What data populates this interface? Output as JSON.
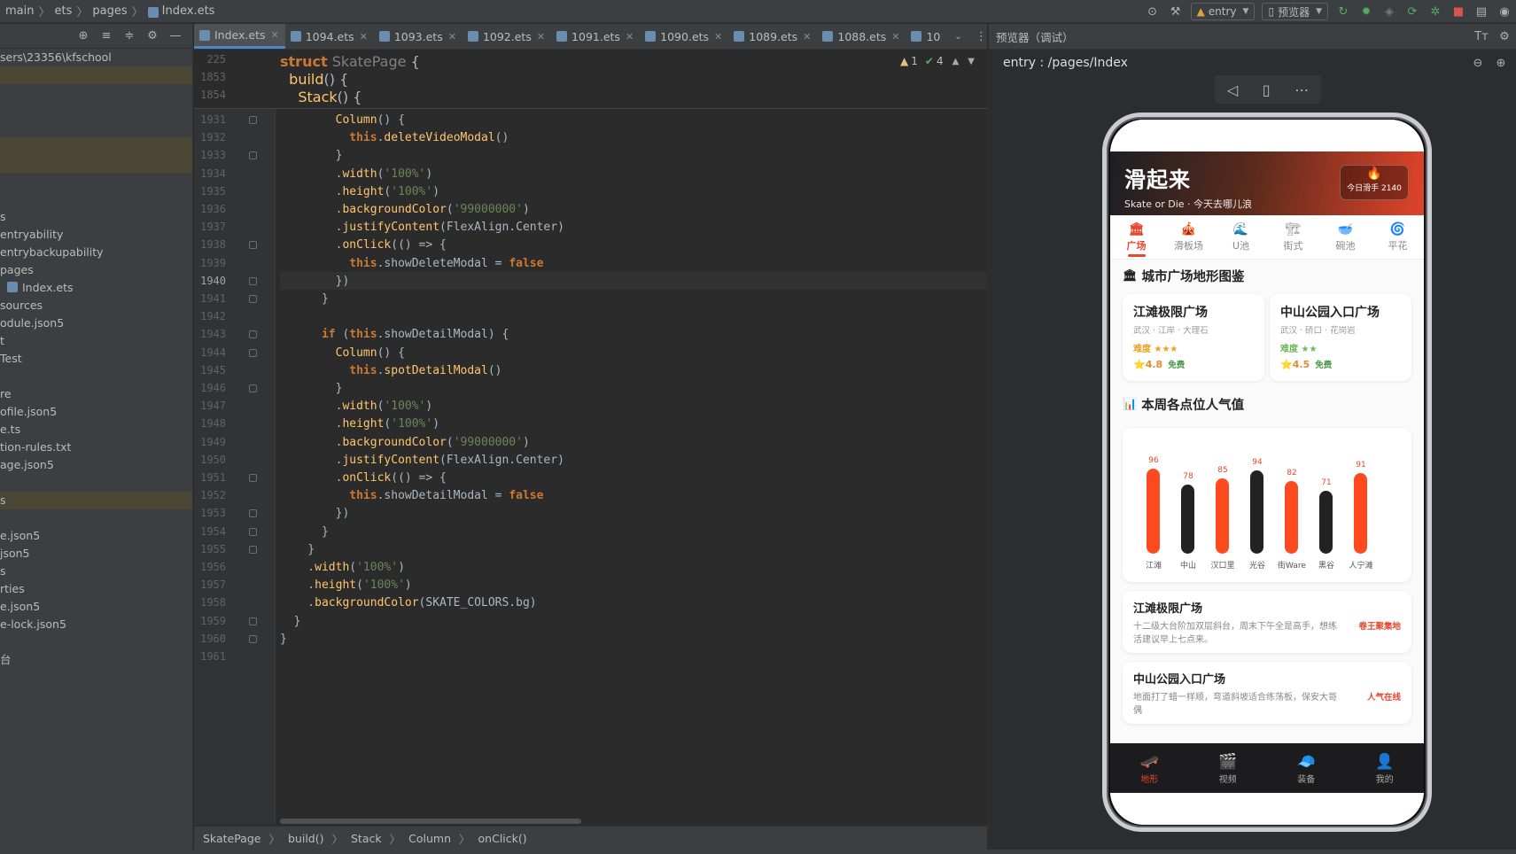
{
  "topbar": {
    "breadcrumb": [
      "main",
      "ets",
      "pages",
      "Index.ets"
    ],
    "module_select": "entry",
    "previewer_select": "预览器"
  },
  "project": {
    "path": "sers\\23356\\kfschool",
    "items": [
      {
        "text": "",
        "hl": true
      },
      {
        "text": "",
        "hl": false
      },
      {
        "text": "",
        "hl": false
      },
      {
        "text": "",
        "hl": false
      },
      {
        "text": "",
        "hl": true
      },
      {
        "text": "",
        "hl": true
      },
      {
        "text": "",
        "hl": false
      },
      {
        "text": "",
        "hl": false
      },
      {
        "text": "s",
        "hl": false
      },
      {
        "text": "entryability",
        "hl": false
      },
      {
        "text": "entrybackupability",
        "hl": false
      },
      {
        "text": "pages",
        "hl": false
      },
      {
        "text": "Index.ets",
        "hl": false,
        "icon": true
      },
      {
        "text": "sources",
        "hl": false
      },
      {
        "text": "odule.json5",
        "hl": false
      },
      {
        "text": "t",
        "hl": false
      },
      {
        "text": "Test",
        "hl": false
      },
      {
        "text": "",
        "hl": false
      },
      {
        "text": "re",
        "hl": false
      },
      {
        "text": "ofile.json5",
        "hl": false
      },
      {
        "text": "e.ts",
        "hl": false
      },
      {
        "text": "tion-rules.txt",
        "hl": false
      },
      {
        "text": "age.json5",
        "hl": false
      },
      {
        "text": "",
        "hl": false
      },
      {
        "text": "s",
        "hl": true
      },
      {
        "text": "",
        "hl": false
      },
      {
        "text": "e.json5",
        "hl": false
      },
      {
        "text": "json5",
        "hl": false
      },
      {
        "text": "s",
        "hl": false
      },
      {
        "text": "rties",
        "hl": false
      },
      {
        "text": "e.json5",
        "hl": false
      },
      {
        "text": "e-lock.json5",
        "hl": false
      },
      {
        "text": "",
        "hl": false
      },
      {
        "text": "台",
        "hl": false
      }
    ]
  },
  "tabs": [
    "Index.ets",
    "1094.ets",
    "1093.ets",
    "1092.ets",
    "1091.ets",
    "1090.ets",
    "1089.ets",
    "1088.ets",
    "10"
  ],
  "inspection": {
    "warnings": "1",
    "ok": "4"
  },
  "editor": {
    "sticky": [
      {
        "ln": "225",
        "html": "<span class='kw'>struct</span> <span class='dim'>SkatePage</span> {"
      },
      {
        "ln": "1853",
        "html": "  <span class='fn'>build</span>() {"
      },
      {
        "ln": "1854",
        "html": "    <span class='fn'>Stack</span>() {"
      }
    ],
    "lines": [
      {
        "ln": "1931",
        "html": "        <span class='fn'>Column</span>() {",
        "fold": true
      },
      {
        "ln": "1932",
        "html": "          <span class='kw'>this</span>.<span class='mth'>deleteVideoModal</span>()"
      },
      {
        "ln": "1933",
        "html": "        }",
        "fold": true
      },
      {
        "ln": "1934",
        "html": "        .<span class='mth'>width</span>(<span class='str'>'100%'</span>)"
      },
      {
        "ln": "1935",
        "html": "        .<span class='mth'>height</span>(<span class='str'>'100%'</span>)"
      },
      {
        "ln": "1936",
        "html": "        .<span class='mth'>backgroundColor</span>(<span class='str'>'99000000'</span>)"
      },
      {
        "ln": "1937",
        "html": "        .<span class='mth'>justifyContent</span>(FlexAlign.Center)"
      },
      {
        "ln": "1938",
        "html": "        .<span class='mth'>onClick</span>(() => {",
        "fold": true
      },
      {
        "ln": "1939",
        "html": "          <span class='kw'>this</span>.showDeleteModal = <span class='kw'>false</span>"
      },
      {
        "ln": "1940",
        "html": "        })",
        "fold": true,
        "cur": true
      },
      {
        "ln": "1941",
        "html": "      }",
        "fold": true
      },
      {
        "ln": "1942",
        "html": ""
      },
      {
        "ln": "1943",
        "html": "      <span class='kw'>if</span> (<span class='kw'>this</span>.showDetailModal) {",
        "fold": true
      },
      {
        "ln": "1944",
        "html": "        <span class='fn'>Column</span>() {",
        "fold": true
      },
      {
        "ln": "1945",
        "html": "          <span class='kw'>this</span>.<span class='mth'>spotDetailModal</span>()"
      },
      {
        "ln": "1946",
        "html": "        }",
        "fold": true
      },
      {
        "ln": "1947",
        "html": "        .<span class='mth'>width</span>(<span class='str'>'100%'</span>)"
      },
      {
        "ln": "1948",
        "html": "        .<span class='mth'>height</span>(<span class='str'>'100%'</span>)"
      },
      {
        "ln": "1949",
        "html": "        .<span class='mth'>backgroundColor</span>(<span class='str'>'99000000'</span>)"
      },
      {
        "ln": "1950",
        "html": "        .<span class='mth'>justifyContent</span>(FlexAlign.Center)"
      },
      {
        "ln": "1951",
        "html": "        .<span class='mth'>onClick</span>(() => {",
        "fold": true
      },
      {
        "ln": "1952",
        "html": "          <span class='kw'>this</span>.showDetailModal = <span class='kw'>false</span>"
      },
      {
        "ln": "1953",
        "html": "        })",
        "fold": true
      },
      {
        "ln": "1954",
        "html": "      }",
        "fold": true
      },
      {
        "ln": "1955",
        "html": "    }",
        "fold": true
      },
      {
        "ln": "1956",
        "html": "    .<span class='mth'>width</span>(<span class='str'>'100%'</span>)"
      },
      {
        "ln": "1957",
        "html": "    .<span class='mth'>height</span>(<span class='str'>'100%'</span>)"
      },
      {
        "ln": "1958",
        "html": "    .<span class='mth'>backgroundColor</span>(SKATE_COLORS.bg)"
      },
      {
        "ln": "1959",
        "html": "  }",
        "fold": true
      },
      {
        "ln": "1960",
        "html": "}",
        "fold": true
      },
      {
        "ln": "1961",
        "html": ""
      }
    ]
  },
  "bottom_breadcrumb": [
    "SkatePage",
    "build()",
    "Stack",
    "Column",
    "onClick()"
  ],
  "previewer": {
    "title": "预览器（调试）",
    "route": "entry : /pages/Index"
  },
  "app": {
    "title": "滑起来",
    "subtitle": "Skate or Die · 今天去哪儿浪",
    "badge_icon": "🔥",
    "badge_text": "今日滑手 2140",
    "categories": [
      {
        "icon": "🏛",
        "label": "广场",
        "on": true
      },
      {
        "icon": "🎪",
        "label": "滑板场",
        "on": false
      },
      {
        "icon": "🌊",
        "label": "U池",
        "on": false
      },
      {
        "icon": "🏗",
        "label": "街式",
        "on": false
      },
      {
        "icon": "🥣",
        "label": "碗池",
        "on": false
      },
      {
        "icon": "🌀",
        "label": "平花",
        "on": false
      }
    ],
    "section1": "城市广场地形图鉴",
    "spots": [
      {
        "name": "江滩极限广场",
        "meta": "武汉 · 江岸 · 大理石",
        "diff": "难度 ★★★",
        "rating": "⭐4.8",
        "free": "免费",
        "green": false
      },
      {
        "name": "中山公园入口广场",
        "meta": "武汉 · 硚口 · 花岗岩",
        "diff": "难度 ★★",
        "rating": "⭐4.5",
        "free": "免费",
        "green": true
      }
    ],
    "section2": "本周各点位人气值",
    "chart_data": {
      "type": "bar",
      "categories": [
        "江滩",
        "中山",
        "汉口里",
        "光谷",
        "街Ware",
        "黑谷",
        "人宁滩"
      ],
      "values": [
        96,
        78,
        85,
        94,
        82,
        71,
        91
      ],
      "colors": [
        "#ff4a1f",
        "#222222",
        "#ff4a1f",
        "#222222",
        "#ff4a1f",
        "#222222",
        "#ff4a1f"
      ],
      "ylim": [
        0,
        100
      ]
    },
    "cards": [
      {
        "name": "江滩极限广场",
        "text": "十二级大台阶加双层斜台，周末下午全是高手，想练活建议早上七点来。",
        "tag": "卷王聚集地"
      },
      {
        "name": "中山公园入口广场",
        "text": "地面打了蜡一样顺，弯道斜坡适合练荡板，保安大哥偶",
        "tag": "人气在线"
      }
    ],
    "tabbar": [
      {
        "icon": "🛹",
        "label": "地形",
        "on": true
      },
      {
        "icon": "🎬",
        "label": "视频",
        "on": false
      },
      {
        "icon": "🧢",
        "label": "装备",
        "on": false
      },
      {
        "icon": "👤",
        "label": "我的",
        "on": false
      }
    ]
  }
}
